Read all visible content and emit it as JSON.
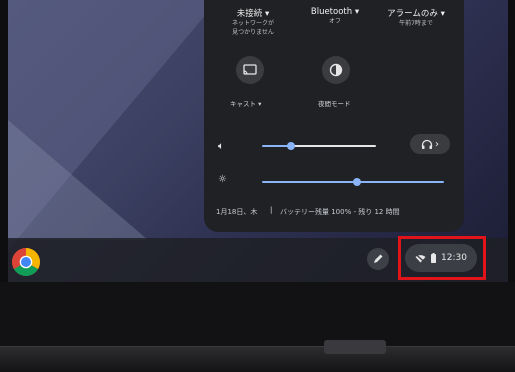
{
  "quick_settings": {
    "network": {
      "title": "未接続 ▾",
      "subtitle_lines": [
        "ネットワークが",
        "見つかりません"
      ]
    },
    "bluetooth": {
      "title": "Bluetooth ▾",
      "subtitle": "オフ"
    },
    "notifications": {
      "title": "アラームのみ ▾",
      "subtitle": "午前7時まで"
    },
    "cast_label": "キャスト ▾",
    "night_mode_label": "夜間モード",
    "volume_level": 0.25,
    "brightness_level": 0.52,
    "footer_date": "1月18日、木",
    "footer_separator": "|",
    "footer_battery": "バッテリー残量 100% - 残り 12 時間"
  },
  "shelf": {
    "time": "12:30"
  },
  "colors": {
    "accent": "#8ab4f8",
    "highlight_box": "#e1141a"
  }
}
